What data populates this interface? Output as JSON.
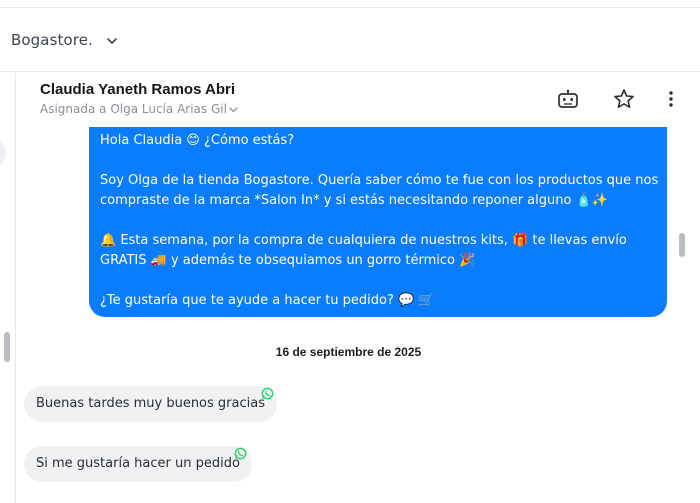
{
  "store": {
    "name": "Bogastore."
  },
  "header": {
    "contact_name": "Claudia Yaneth Ramos Abri",
    "assigned": "Asignada a Olga Lucía Arias Gil",
    "icons": [
      "robot-icon",
      "star-icon",
      "more-vertical-icon"
    ]
  },
  "messages": {
    "outgoing": {
      "line1": "Hola  Claudia 😊 ¿Cómo estás?",
      "line2": "Soy Olga de la tienda Bogastore. Quería saber cómo te fue con los productos que nos",
      "line3": "compraste de la marca *Salon In* y si estás necesitando reponer alguno 🧴✨",
      "line4": "🔔 Esta semana, por la compra de cualquiera de nuestros kits, 🎁 te llevas envío",
      "line5": "GRATIS 🚚 y además te obsequiamos un gorro térmico 🎉",
      "line6": "¿Te gustaría que te ayude a hacer tu pedido? 💬 🛒"
    },
    "date_separator": "16 de septiembre de 2025",
    "incoming": [
      {
        "text": "Buenas tardes muy buenos gracias",
        "channel_icon": "whatsapp-icon"
      },
      {
        "text": "Si me gustaría hacer un pedido",
        "channel_icon": "whatsapp-icon"
      }
    ]
  },
  "colors": {
    "accent": "#0a7cff",
    "incoming_bubble": "#f0f1f3",
    "whatsapp": "#25d366"
  }
}
